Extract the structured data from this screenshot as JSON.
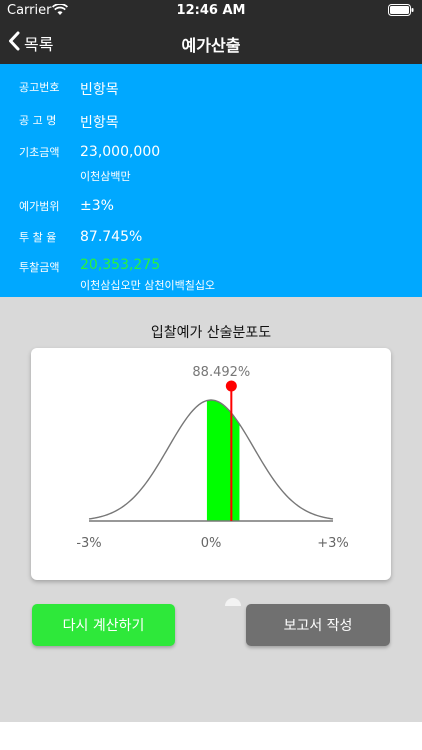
{
  "status_bar": {
    "carrier": "Carrier",
    "time": "12:46 AM"
  },
  "nav": {
    "back_label": "목록",
    "title": "예가산출"
  },
  "info": {
    "rows": [
      {
        "label": "공고번호",
        "value": "빈항목"
      },
      {
        "label": "공 고 명",
        "value": "빈항목"
      },
      {
        "label": "기초금액",
        "value": "23,000,000",
        "sub": "이천삼백만"
      },
      {
        "label": "예가범위",
        "value": "±3%"
      },
      {
        "label": "투 찰 율",
        "value": "87.745%"
      },
      {
        "label": "투찰금액",
        "value": "20,353,275",
        "sub": "이천삼십오만 삼천이백칠십오"
      }
    ]
  },
  "chart_section_title": "입찰예가 산술분포도",
  "chart_data": {
    "type": "area",
    "marker_label": "88.492%",
    "marker_position": 0.5,
    "highlight_range": [
      -0.1,
      0.7
    ],
    "x_tick_labels": [
      "-3%",
      "0%",
      "+3%"
    ],
    "xlim": [
      -3,
      3
    ],
    "colors": {
      "curve": "#777777",
      "highlight": "#00ff00",
      "marker": "#ff0000"
    }
  },
  "buttons": {
    "recalc": "다시 계산하기",
    "report": "보고서 작성"
  },
  "colors": {
    "header": "#2b2b2b",
    "info_bg": "#00a8ff",
    "green_value": "#28f43c",
    "lower_bg": "#d9d9d9"
  }
}
